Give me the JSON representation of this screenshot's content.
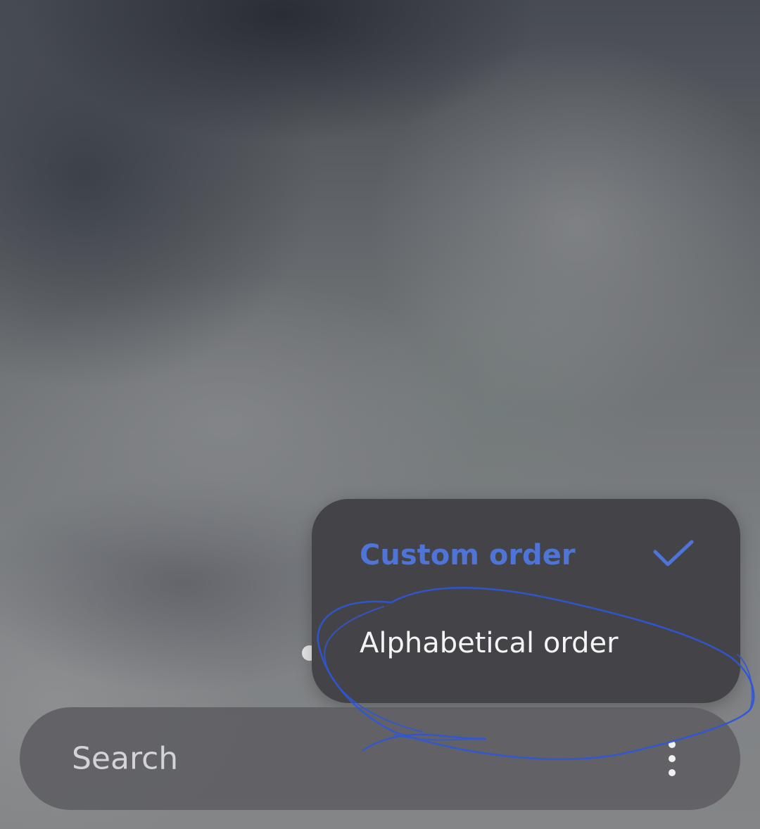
{
  "menu": {
    "items": [
      {
        "label": "Custom order",
        "selected": true,
        "icon": "check-icon"
      },
      {
        "label": "Alphabetical order",
        "selected": false
      }
    ],
    "accent_color": "#4d74d6",
    "background_color": "#444448"
  },
  "search": {
    "placeholder": "Search",
    "more_icon": "more-vertical-icon"
  },
  "annotation": {
    "color": "#2f56d6",
    "shape": "hand-drawn-circle"
  },
  "page_indicator": {
    "icon": "page-dot-icon"
  }
}
